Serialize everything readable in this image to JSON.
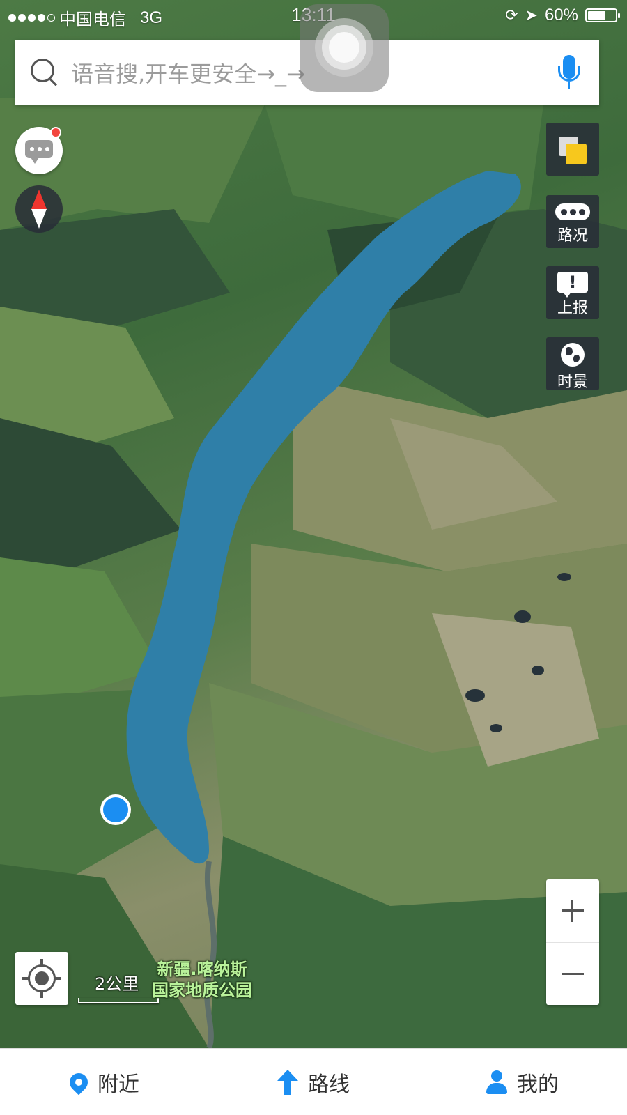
{
  "status_bar": {
    "carrier": "中国电信",
    "network": "3G",
    "time": "13:11",
    "battery": "60%"
  },
  "search": {
    "placeholder": "语音搜,开车更安全→_→"
  },
  "map_controls": {
    "traffic_label": "路况",
    "report_label": "上报",
    "timescape_label": "时景"
  },
  "map": {
    "scale_label": "2公里",
    "poi_line1": "新疆.喀纳斯",
    "poi_line2": "国家地质公园",
    "lake_color": "#2f7fa8"
  },
  "tabbar": {
    "nearby": "附近",
    "route": "路线",
    "mine": "我的"
  },
  "colors": {
    "accent": "#1b8ef2",
    "badge": "#f2473f",
    "compass_north": "#f0352e",
    "layer_yellow": "#f7c81d"
  },
  "icons": {
    "search": "search-icon",
    "mic": "microphone-icon",
    "message": "message-icon",
    "compass": "compass-icon",
    "layers": "layers-icon",
    "traffic": "traffic-icon",
    "report": "report-icon",
    "timescape": "globe-icon",
    "locate": "locate-icon",
    "nearby": "location-pin-icon",
    "route": "route-arrow-icon",
    "mine": "user-icon"
  }
}
